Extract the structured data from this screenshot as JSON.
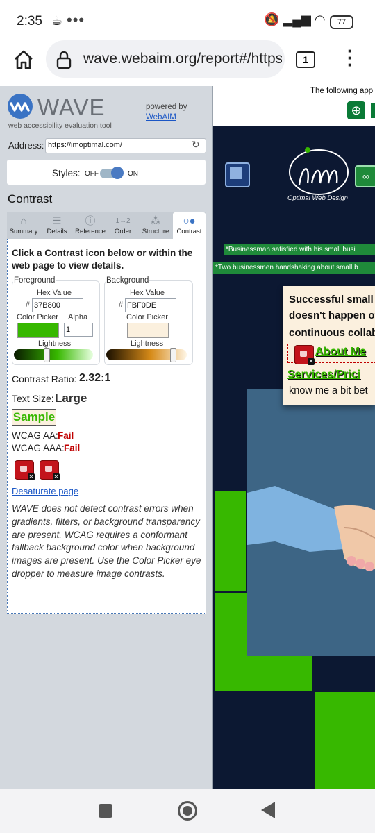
{
  "status_bar": {
    "time": "2:35",
    "battery": "77"
  },
  "browser": {
    "url": "wave.webaim.org/report#/https",
    "tab_count": "1"
  },
  "wave": {
    "brand": "WAVE",
    "tagline": "web accessibility evaluation tool",
    "powered_by": "powered by",
    "webaim_link": "WebAIM",
    "address_label": "Address:",
    "address_value": "https://imoptimal.com/",
    "styles_label": "Styles:",
    "styles_off": "OFF",
    "styles_on": "ON",
    "section_title": "Contrast",
    "tabs": [
      {
        "label": "Summary",
        "icon": "home-icon"
      },
      {
        "label": "Details",
        "icon": "list-icon"
      },
      {
        "label": "Reference",
        "icon": "info-icon"
      },
      {
        "label": "Order",
        "icon": "order-icon"
      },
      {
        "label": "Structure",
        "icon": "structure-icon"
      },
      {
        "label": "Contrast",
        "icon": "contrast-icon"
      }
    ],
    "instructions": "Click a Contrast icon below or within the web page to view details.",
    "foreground": {
      "legend": "Foreground",
      "hex_label": "Hex Value",
      "hex": "37B800",
      "picker_label": "Color Picker",
      "alpha_label": "Alpha",
      "alpha": "1",
      "lightness_label": "Lightness",
      "color": "#37b800"
    },
    "background": {
      "legend": "Background",
      "hex_label": "Hex Value",
      "hex": "FBF0DE",
      "picker_label": "Color Picker",
      "lightness_label": "Lightness",
      "color": "#fbf0de"
    },
    "contrast_ratio_label": "Contrast Ratio:",
    "contrast_ratio": "2.32:1",
    "text_size_label": "Text Size:",
    "text_size": "Large",
    "sample": "Sample",
    "wcag_aa_label": "WCAG AA:",
    "wcag_aa": "Fail",
    "wcag_aaa_label": "WCAG AAA:",
    "wcag_aaa": "Fail",
    "desaturate": "Desaturate page",
    "note": "WAVE does not detect contrast errors when gradients, filters, or background transparency are present. WCAG requires a conformant fallback background color when background images are present. Use the Color Picker eye dropper to measure image contrasts."
  },
  "preview": {
    "following": "The following app",
    "logo_text": "Optimal Web Design",
    "alt1": "*Businessman satisfied with his small busi",
    "alt2": "*Two businessmen handshaking about small b",
    "line1": "Successful small",
    "line2": "doesn't happen ov",
    "line3": "continuous collab",
    "about_link": "About Me",
    "services_link": "Services/Prici",
    "know_text": "know me a bit bet"
  }
}
